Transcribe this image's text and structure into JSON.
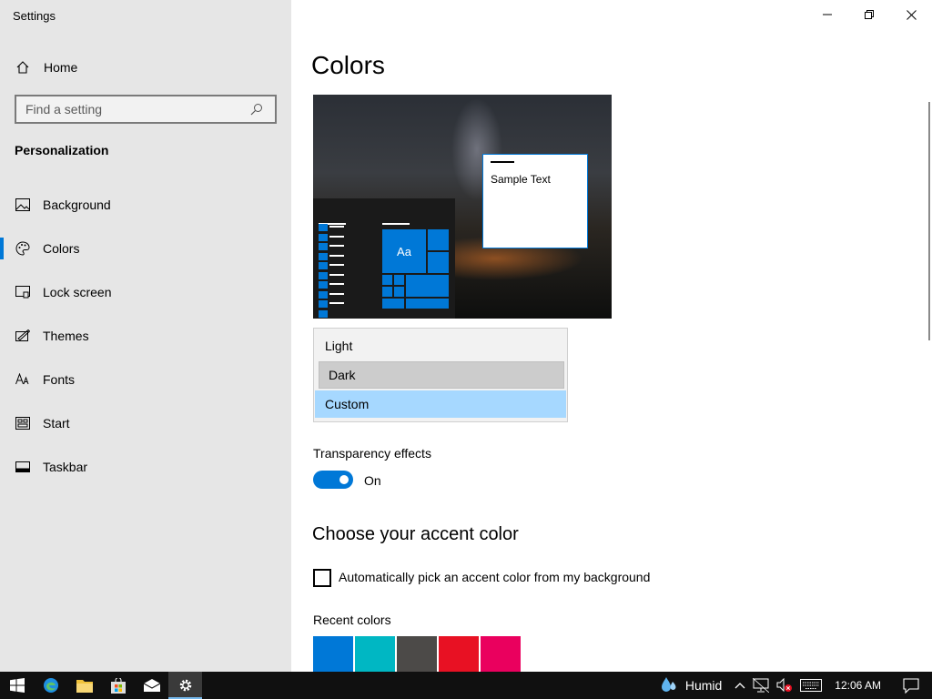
{
  "window": {
    "title": "Settings",
    "controls": {
      "minimize": "minimize-icon",
      "restore": "restore-icon",
      "close": "close-icon"
    }
  },
  "sidebar": {
    "home_label": "Home",
    "search_placeholder": "Find a setting",
    "section_title": "Personalization",
    "items": [
      {
        "label": "Background",
        "icon": "picture-icon"
      },
      {
        "label": "Colors",
        "icon": "palette-icon",
        "selected": true
      },
      {
        "label": "Lock screen",
        "icon": "lock-screen-icon"
      },
      {
        "label": "Themes",
        "icon": "themes-icon"
      },
      {
        "label": "Fonts",
        "icon": "fonts-icon"
      },
      {
        "label": "Start",
        "icon": "start-icon"
      },
      {
        "label": "Taskbar",
        "icon": "taskbar-icon"
      }
    ]
  },
  "main": {
    "page_title": "Colors",
    "preview": {
      "tile_label": "Aa",
      "sample_text": "Sample Text"
    },
    "mode_options": [
      {
        "label": "Light",
        "state": "normal"
      },
      {
        "label": "Dark",
        "state": "hover"
      },
      {
        "label": "Custom",
        "state": "selected"
      }
    ],
    "transparency": {
      "label": "Transparency effects",
      "state": "On",
      "enabled": true
    },
    "accent": {
      "title": "Choose your accent color",
      "auto_pick_label": "Automatically pick an accent color from my background",
      "auto_pick_checked": false,
      "recent_label": "Recent colors",
      "recent_colors": [
        "#0078d7",
        "#00b7c3",
        "#4c4a48",
        "#e81123",
        "#ea005e"
      ]
    }
  },
  "taskbar": {
    "weather": "Humid",
    "clock": "12:06 AM",
    "accent_color": "#0078d7"
  }
}
